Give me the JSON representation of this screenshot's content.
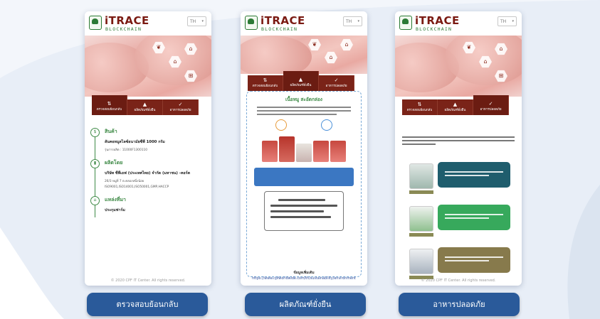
{
  "brand": {
    "name": "iTRACE",
    "sub": "BLOCKCHAIN",
    "lang": "TH"
  },
  "footer": "© 2020 CPF IT Center. All rights reserved.",
  "tabs": [
    {
      "label": "ตรวจสอบย้อนกลับ",
      "icon": "⇅"
    },
    {
      "label": "ผลิตภัณฑ์ยั่งยืน",
      "icon": "▲"
    },
    {
      "label": "อาหารปลอดภัย",
      "icon": "✓"
    }
  ],
  "screen1": {
    "product_title": "สินค้า",
    "product_name": "สันคอหมูสไลซ์อนามัยซีพี 1000 กรัม",
    "product_code": "รุ่นการผลิต : 11000F1300110",
    "producer_title": "ผลิตโดย",
    "producer_name": "บริษัท ซีพีเอฟ (ประเทศไทย) จำกัด (มหาชน) -คอร์ต",
    "producer_addr": "26/3 หมู่ที่ 7 ต.คลองหนึ่งน้อย",
    "producer_cert": "ISO9001,ISO14001,ISO50001,GMP,HACCP",
    "origin_title": "แหล่งที่มา",
    "origin_value": "ประกุมฟาร์ม"
  },
  "screen2": {
    "card_title": "เนื้อหมู สะอัดกล่อง",
    "source_label": "ข้อมูลเพิ่มเติม",
    "source_url": "https://www.cpfworldwide.com/th/sustainability/environment"
  },
  "buttons": [
    {
      "label": "ตรวจสอบย้อนกลับ"
    },
    {
      "label": "ผลิตภัณฑ์ยั่งยืน"
    },
    {
      "label": "อาหารปลอดภัย"
    }
  ],
  "colors": {
    "brand_red": "#7a2318",
    "brand_green": "#3e8a46",
    "button_blue": "#2a5a9a"
  }
}
